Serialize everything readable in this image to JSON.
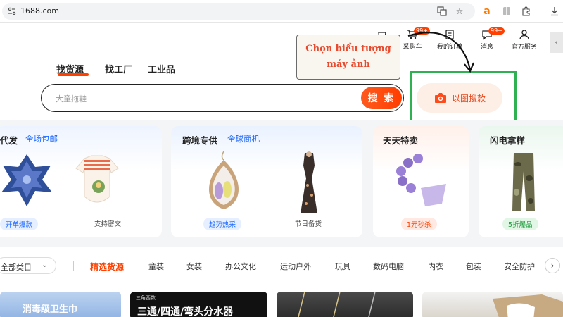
{
  "browser": {
    "url": "1688.com"
  },
  "header": {
    "cart_label": "采购车",
    "cart_badge": "99+",
    "orders_label": "我的订单",
    "messages_label": "消息",
    "messages_badge": "99+",
    "service_label": "官方服务"
  },
  "tabs": [
    "找货源",
    "找工厂",
    "工业品"
  ],
  "search": {
    "placeholder": "大童拖鞋",
    "button_label": "搜 索",
    "image_search_label": "以图搜款"
  },
  "annotation": {
    "line1": "Chọn biểu tượng",
    "line2": "máy ảnh"
  },
  "cards": {
    "c1": {
      "title": "代发",
      "subtitle": "全场包邮",
      "pill": "开单爆款",
      "caption": "支持密文"
    },
    "c2": {
      "title": "跨境专供",
      "subtitle": "全球商机",
      "pill": "趋势热采",
      "caption": "节日备货"
    },
    "c3": {
      "title": "天天特卖",
      "pill": "1元秒杀"
    },
    "c4": {
      "title": "闪电拿样",
      "pill": "5折爆品"
    }
  },
  "categories": {
    "all": "全部类目",
    "items": [
      "精选货源",
      "童装",
      "女装",
      "办公文化",
      "运动户外",
      "玩具",
      "数码电脑",
      "内衣",
      "包装",
      "安全防护"
    ]
  },
  "banners": {
    "b1": "消毒级卫生巾",
    "b2_small": "三角西数",
    "b2": "三通/四通/弯头分水器"
  },
  "colors": {
    "accent": "#ff4000",
    "link_blue": "#1a66ff",
    "annotation_green": "#2fb152",
    "annotation_red": "#e8482c"
  }
}
